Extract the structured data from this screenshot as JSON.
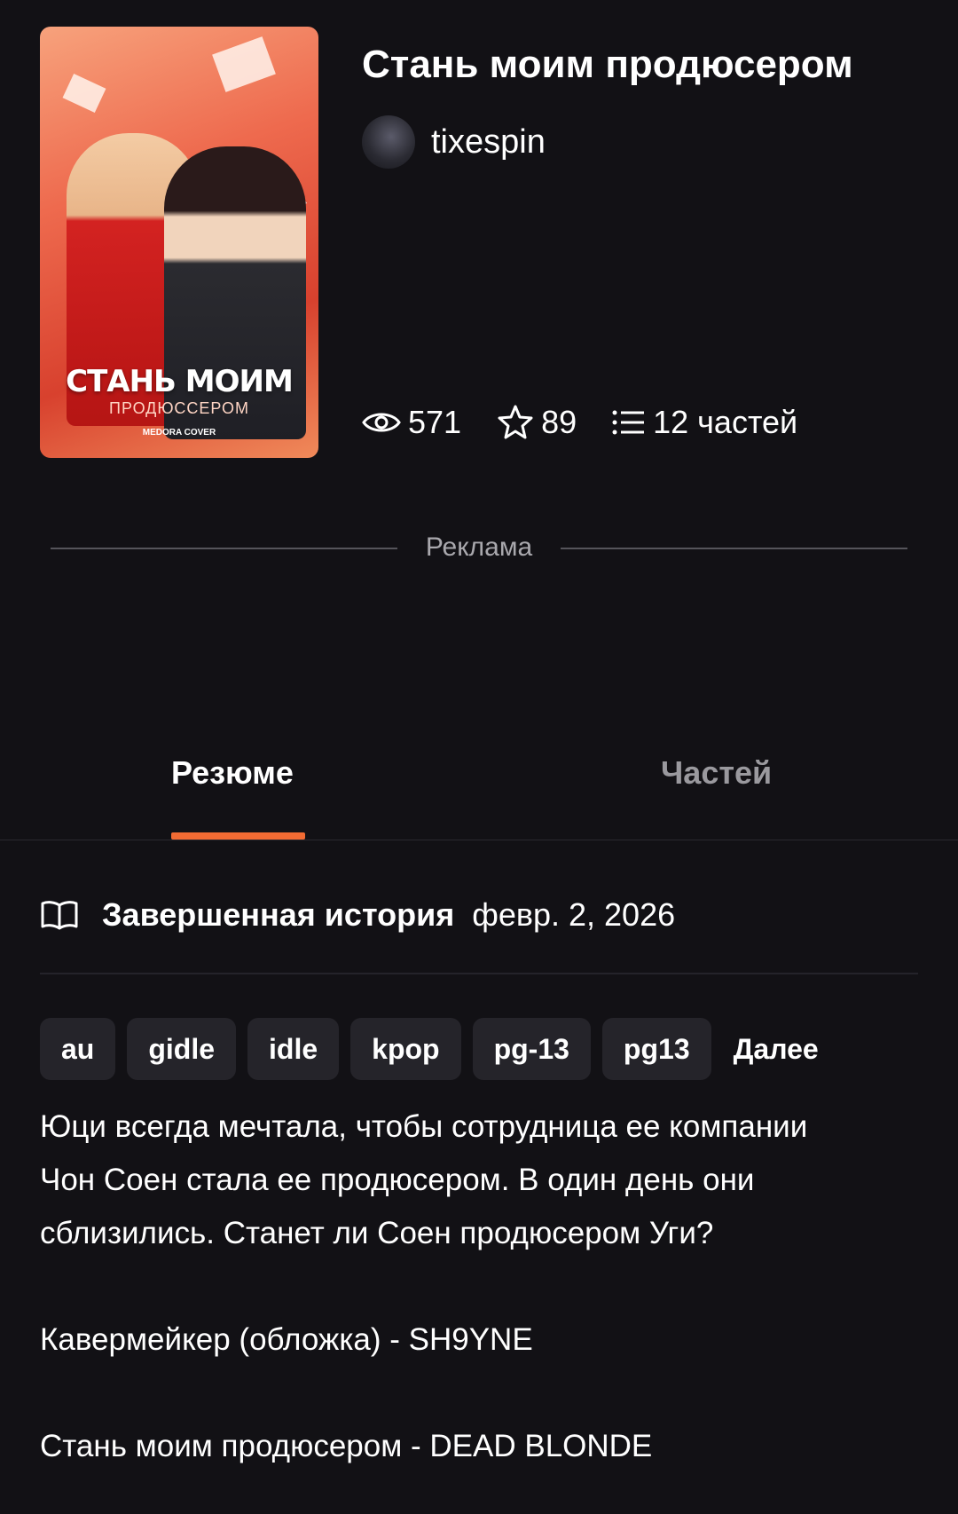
{
  "story": {
    "title": "Стань моим продюсером",
    "author": "tixespin",
    "cover": {
      "title": "СТАНЬ МОИМ",
      "subtitle": "ПРОДЮССЕРОМ",
      "credit": "MEDORA COVER",
      "colors": [
        "#f7a27c",
        "#d8412e"
      ]
    }
  },
  "stats": {
    "views": "571",
    "votes": "89",
    "parts": "12 частей"
  },
  "ad": {
    "label": "Реклама"
  },
  "tabs": [
    {
      "label": "Резюме",
      "active": true
    },
    {
      "label": "Частей",
      "active": false
    }
  ],
  "status": {
    "label": "Завершенная история",
    "date": "февр. 2, 2026"
  },
  "tags": [
    "au",
    "gidle",
    "idle",
    "kpop",
    "pg-13",
    "pg13"
  ],
  "tags_more": "Далее",
  "description": {
    "line1": "Юци всегда мечтала, чтобы сотрудница ее компании",
    "line2": "Чон Соен стала ее продюсером. В один день они",
    "line3": "сблизились. Станет ли Соен продюсером Уги?",
    "line4": "Кавермейкер (обложка) - SH9YNE",
    "line5": "Стань моим продюсером - DEAD BLONDE"
  },
  "accent_color": "#f26b33"
}
